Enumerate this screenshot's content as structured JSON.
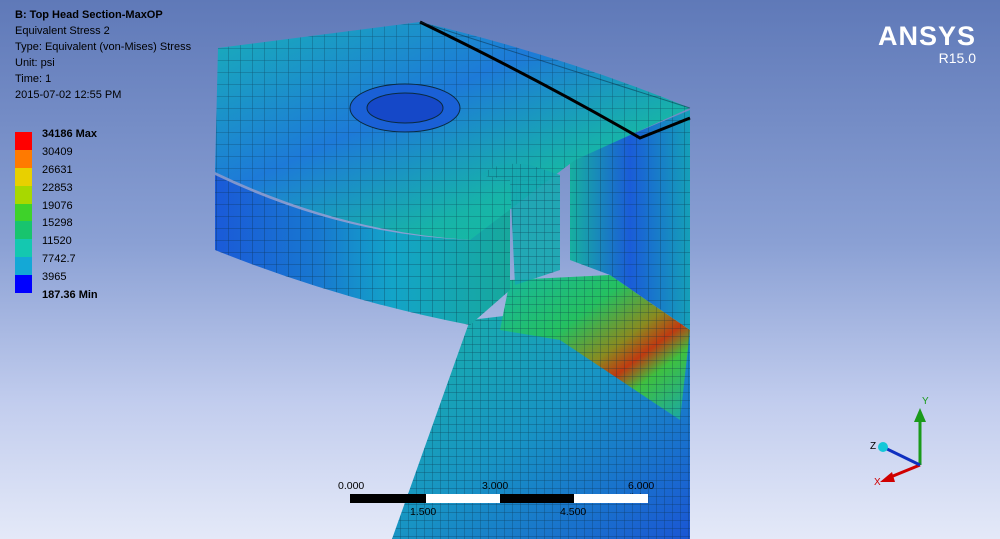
{
  "info": {
    "title": "B: Top Head Section-MaxOP",
    "result_name": "Equivalent Stress 2",
    "type_line": "Type: Equivalent (von-Mises) Stress",
    "unit_line": "Unit: psi",
    "time_line": "Time: 1",
    "timestamp": "2015-07-02 12:55 PM"
  },
  "legend": {
    "levels": [
      {
        "label": "34186 Max",
        "color": "#ff0000",
        "bold": true
      },
      {
        "label": "30409",
        "color": "#ff7a00",
        "bold": false
      },
      {
        "label": "26631",
        "color": "#e8d000",
        "bold": false
      },
      {
        "label": "22853",
        "color": "#a8d800",
        "bold": false
      },
      {
        "label": "19076",
        "color": "#3ed22a",
        "bold": false
      },
      {
        "label": "15298",
        "color": "#18c46e",
        "bold": false
      },
      {
        "label": "11520",
        "color": "#14c8b0",
        "bold": false
      },
      {
        "label": "7742.7",
        "color": "#14a8d6",
        "bold": false
      },
      {
        "label": "3965",
        "color": "#1870e0",
        "bold": false
      },
      {
        "label": "187.36 Min",
        "color": "#0000ff",
        "bold": true
      }
    ]
  },
  "brand": {
    "name": "ANSYS",
    "version": "R15.0"
  },
  "scale": {
    "top_left": "0.000",
    "top_mid": "3.000",
    "top_right": "6.000 (in)",
    "bottom_left": "1.500",
    "bottom_right": "4.500"
  },
  "triad": {
    "x": "X",
    "y": "Y",
    "z": "Z"
  }
}
